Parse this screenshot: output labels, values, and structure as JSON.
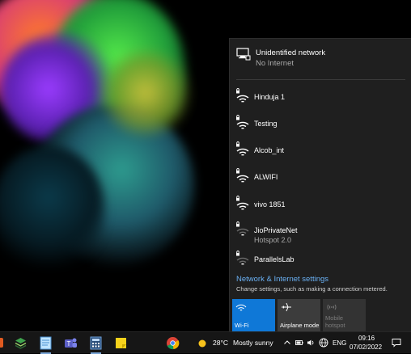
{
  "connection": {
    "name": "Unidentified network",
    "status": "No Internet"
  },
  "networks": [
    {
      "name": "Hinduja 1",
      "secured": true
    },
    {
      "name": "Testing",
      "secured": true
    },
    {
      "name": "Alcob_int",
      "secured": true
    },
    {
      "name": "ALWIFI",
      "secured": true
    },
    {
      "name": "vivo 1851",
      "secured": true
    },
    {
      "name": "JioPrivateNet",
      "subtitle": "Hotspot 2.0",
      "secured": true
    },
    {
      "name": "ParallelsLab",
      "secured": true
    }
  ],
  "settings": {
    "link": "Network & Internet settings",
    "description": "Change settings, such as making a connection metered."
  },
  "tiles": [
    {
      "label": "Wi-Fi",
      "state": "active",
      "icon": "wifi-icon"
    },
    {
      "label": "Airplane mode",
      "state": "off",
      "icon": "airplane-icon"
    },
    {
      "label": "Mobile hotspot",
      "label_line1": "Mobile",
      "label_line2": "hotspot",
      "state": "disabled",
      "icon": "hotspot-icon"
    }
  ],
  "taskbar": {
    "weather_temp": "28°C",
    "weather_text": "Mostly sunny",
    "language": "ENG",
    "time": "09:16",
    "date": "07/02/2022"
  },
  "colors": {
    "accent": "#0f78d7",
    "link": "#6ab0f3",
    "flyout_bg": "#1f1f1f",
    "taskbar_bg": "#161616"
  }
}
